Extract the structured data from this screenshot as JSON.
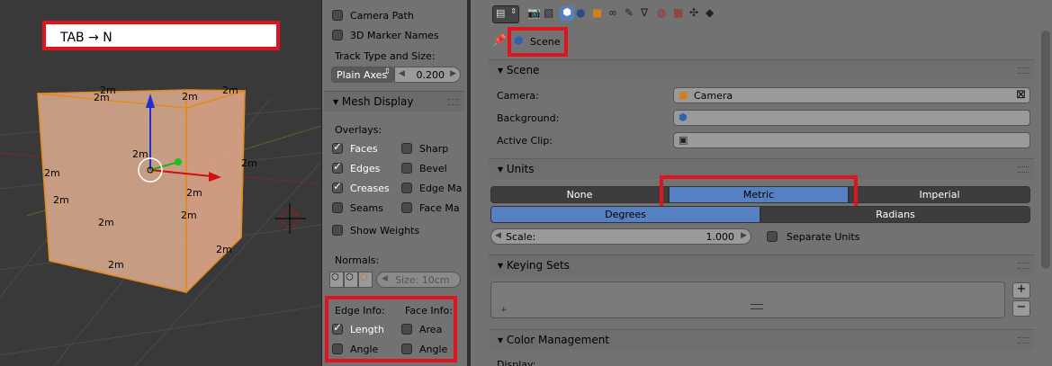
{
  "viewport": {
    "note": "TAB → N",
    "dimensions": [
      "2m",
      "2m",
      "2m",
      "2m",
      "2m",
      "2m",
      "2m",
      "2m",
      "2m",
      "2m",
      "2m",
      "2m",
      "2m"
    ]
  },
  "npanel": {
    "camera_path": "Camera Path",
    "marker_names": "3D Marker Names",
    "track_type_label": "Track Type and Size:",
    "track_type_value": "Plain Axes",
    "track_size": "0.200",
    "mesh_display": "Mesh Display",
    "overlays": "Overlays:",
    "faces": "Faces",
    "sharp": "Sharp",
    "edges": "Edges",
    "bevel": "Bevel",
    "creases": "Creases",
    "edge_marks": "Edge Ma",
    "seams": "Seams",
    "face_marks": "Face Ma",
    "show_weights": "Show Weights",
    "normals": "Normals:",
    "normal_size": "Size: 10cm",
    "edge_info": "Edge Info:",
    "face_info": "Face Info:",
    "length": "Length",
    "area": "Area",
    "angle_edge": "Angle",
    "angle_face": "Angle"
  },
  "properties": {
    "context": "Scene",
    "scene_section": "Scene",
    "camera_label": "Camera:",
    "camera_value": "Camera",
    "background_label": "Background:",
    "active_clip_label": "Active Clip:",
    "units_section": "Units",
    "unit_none": "None",
    "unit_metric": "Metric",
    "unit_imperial": "Imperial",
    "degrees": "Degrees",
    "radians": "Radians",
    "scale_label": "Scale:",
    "scale_value": "1.000",
    "separate_units": "Separate Units",
    "keying_sets_section": "Keying Sets",
    "color_mgmt_section": "Color Management",
    "display_label": "Display:"
  },
  "colors": {
    "highlight": "#e0141e",
    "selected": "#5680c2",
    "cube_face": "#e8b896"
  }
}
